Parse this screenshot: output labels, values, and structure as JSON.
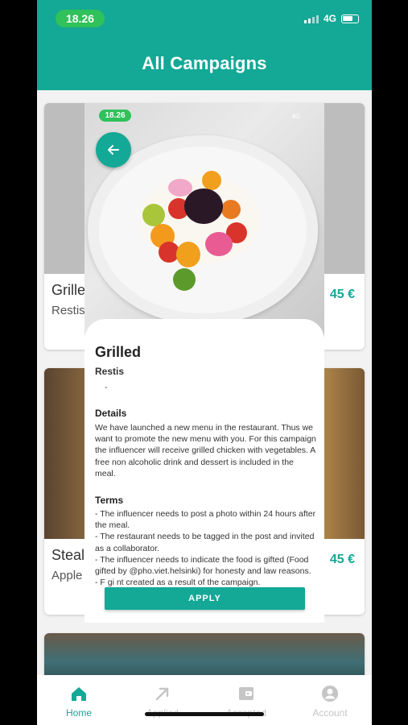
{
  "status_bar": {
    "time": "18.26",
    "network": "4G"
  },
  "header": {
    "title": "All Campaigns"
  },
  "cards": [
    {
      "title": "Grille",
      "subtitle": "Restis",
      "price": "45 €"
    },
    {
      "title": "Steal",
      "subtitle": "Apple",
      "price": "45 €"
    }
  ],
  "overlay": {
    "status_time": "18.26",
    "status_network": "4G",
    "back_icon": "arrow-left-icon",
    "title": "Grilled",
    "subtitle": "Restis",
    "dash": "-",
    "details_title": "Details",
    "details_text": "We have launched a new menu in the restaurant. Thus we want to promote the new menu with you. For this campaign the influencer will receive grilled chicken with vegetables. A free non alcoholic drink and dessert is included in the meal.",
    "terms_title": "Terms",
    "terms_text": "- The influencer needs to post a photo within 24 hours after the meal.\n- The restaurant needs to be tagged in the post and invited as a collaborator.\n- The influencer needs to indicate the food is gifted (Food gifted by @pho.viet.helsinki) for honesty and law reasons.\n- F                                                              gi                                                              nt created as a result of the campaign.",
    "apply_label": "APPLY"
  },
  "bottom_nav": [
    {
      "label": "Home",
      "icon": "home-icon",
      "active": true
    },
    {
      "label": "Applied",
      "icon": "arrow-up-right-icon",
      "active": false
    },
    {
      "label": "Accepted",
      "icon": "wallet-icon",
      "active": false
    },
    {
      "label": "Account",
      "icon": "account-icon",
      "active": false
    }
  ],
  "colors": {
    "accent": "#14a896",
    "status_pill": "#2fc15a",
    "background": "#f2f2f2"
  }
}
